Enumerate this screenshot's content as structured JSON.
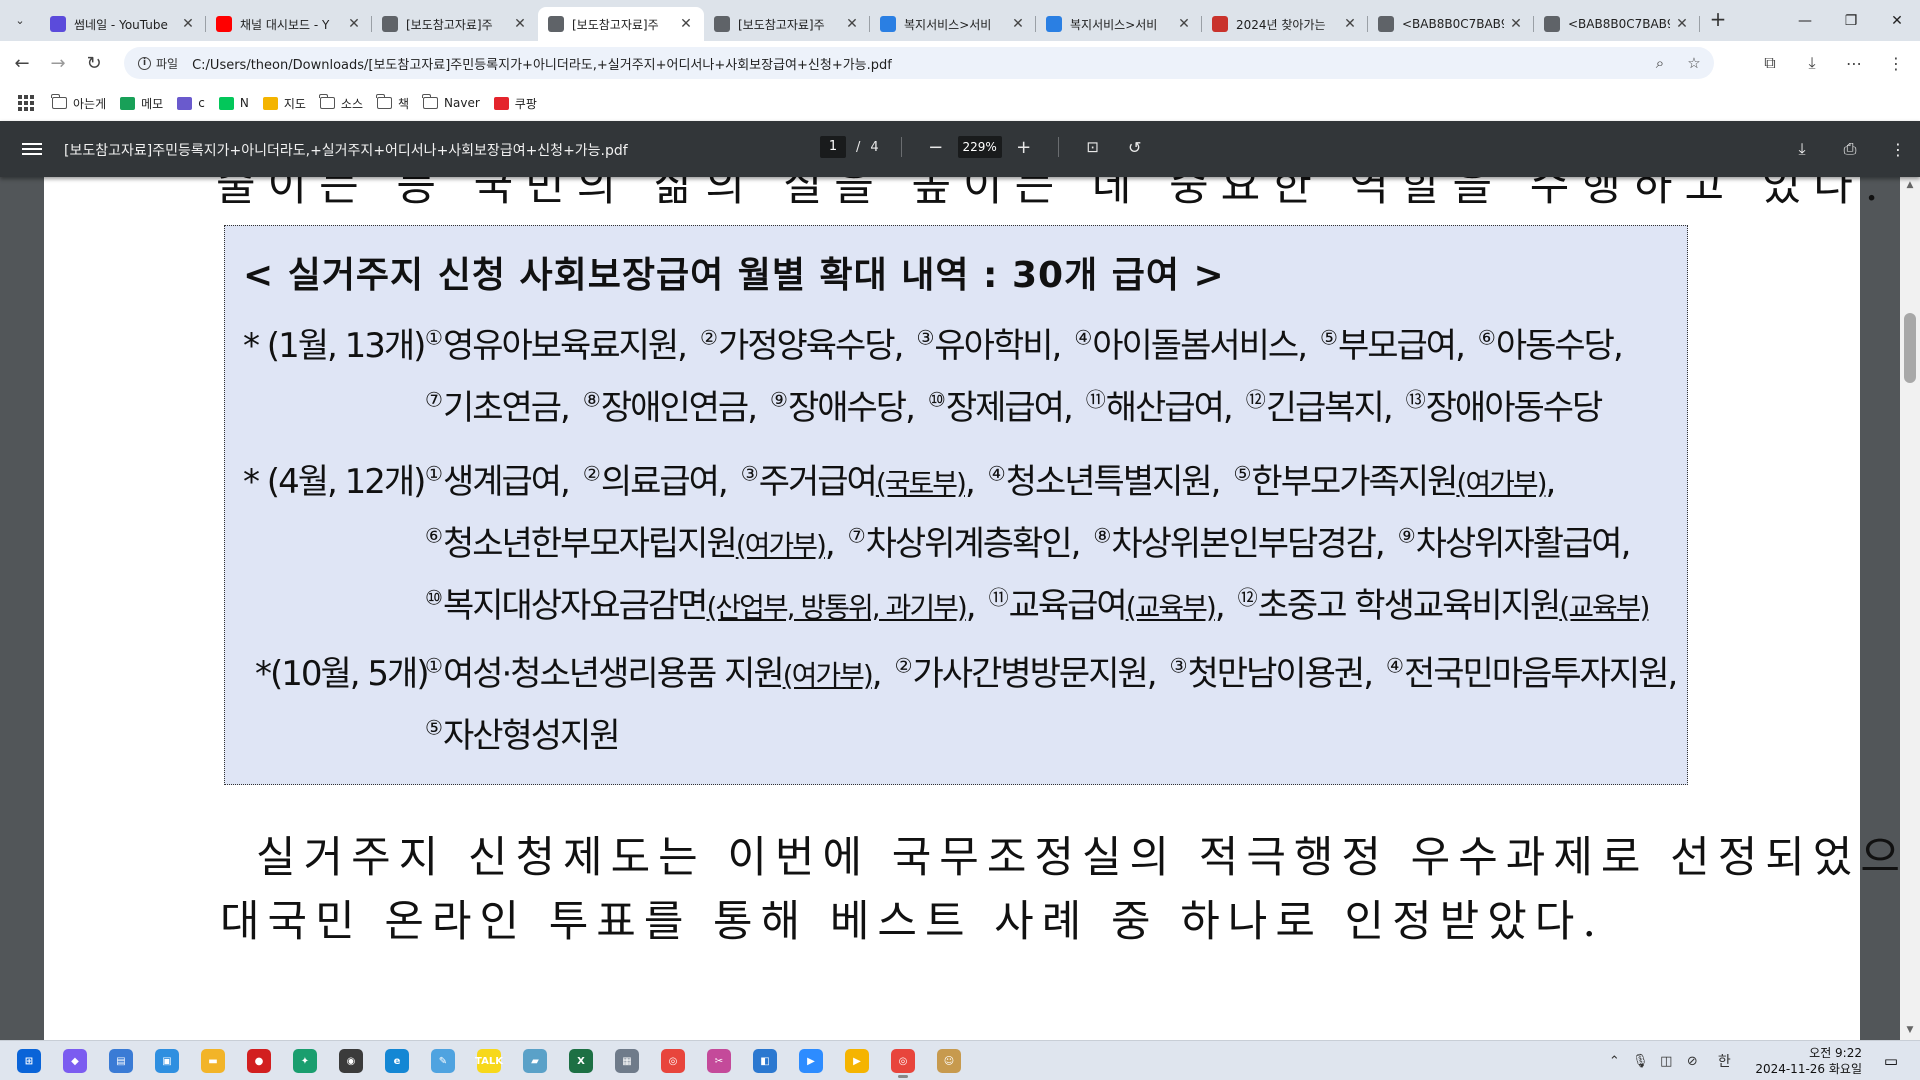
{
  "browser": {
    "tabs": [
      {
        "title": "썸네일 - YouTube",
        "icon": "youtube-studio-icon",
        "color": "#5b4bdb",
        "active": false
      },
      {
        "title": "채널 대시보드 - Y",
        "icon": "youtube-icon",
        "color": "#ff0000",
        "active": false
      },
      {
        "title": "[보도참고자료]주",
        "icon": "globe-icon",
        "color": "#5f6368",
        "active": false
      },
      {
        "title": "[보도참고자료]주",
        "icon": "globe-icon",
        "color": "#5f6368",
        "active": true
      },
      {
        "title": "[보도참고자료]주",
        "icon": "globe-icon",
        "color": "#5f6368",
        "active": false
      },
      {
        "title": "복지서비스>서비",
        "icon": "bokjiro-icon",
        "color": "#2a7fe3",
        "active": false
      },
      {
        "title": "복지서비스>서비",
        "icon": "bokjiro-icon",
        "color": "#2a7fe3",
        "active": false
      },
      {
        "title": "2024년 찾아가는",
        "icon": "korea-gov-icon",
        "color": "#c9332c",
        "active": false
      },
      {
        "title": "<BAB8B0C7BAB9",
        "icon": "globe-icon",
        "color": "#5f6368",
        "active": false
      },
      {
        "title": "<BAB8B0C7BAB9",
        "icon": "globe-icon",
        "color": "#5f6368",
        "active": false
      }
    ],
    "address": {
      "chip": "파일",
      "url": "C:/Users/theon/Downloads/[보도참고자료]주민등록지가+아니더라도,+실거주지+어디서나+사회보장급여+신청+가능.pdf"
    },
    "bookmarks": [
      {
        "label": "아는게",
        "type": "folder"
      },
      {
        "label": "메모",
        "type": "site",
        "color": "#18a058",
        "icon": "memo-icon"
      },
      {
        "label": "c",
        "type": "site",
        "color": "#6a5acd",
        "icon": "calendar-icon"
      },
      {
        "label": "N",
        "type": "site",
        "color": "#03c75a",
        "icon": "naver-icon"
      },
      {
        "label": "지도",
        "type": "site",
        "color": "#f4b400",
        "icon": "map-pin-icon"
      },
      {
        "label": "소스",
        "type": "folder"
      },
      {
        "label": "책",
        "type": "folder"
      },
      {
        "label": "Naver",
        "type": "folder"
      },
      {
        "label": "쿠팡",
        "type": "site",
        "color": "#e4242c",
        "icon": "coupang-icon"
      }
    ]
  },
  "pdf": {
    "title": "[보도참고자료]주민등록지가+아니더라도,+실거주지+어디서나+사회보장급여+신청+가능.pdf",
    "page_current": "1",
    "page_sep": "/",
    "page_total": "4",
    "zoom": "229%"
  },
  "document": {
    "top_line": "줄이는 등 국민의 삶의 질을 높이는 데 중요한 역할을 수행하고 있다.",
    "box_title": "< 실거주지 신청 사회보장급여 월별 확대 내역 : 30개 급여 >",
    "jan_label": "* (1월, 13개)",
    "jan_line1": [
      {
        "n": "①",
        "t": "영유아보육료지원,"
      },
      {
        "n": "②",
        "t": "가정양육수당,"
      },
      {
        "n": "③",
        "t": "유아학비,"
      },
      {
        "n": "④",
        "t": "아이돌봄서비스,"
      },
      {
        "n": "⑤",
        "t": "부모급여,"
      },
      {
        "n": "⑥",
        "t": "아동수당,"
      }
    ],
    "jan_line2": [
      {
        "n": "⑦",
        "t": "기초연금,"
      },
      {
        "n": "⑧",
        "t": "장애인연금,"
      },
      {
        "n": "⑨",
        "t": "장애수당,"
      },
      {
        "n": "⑩",
        "t": "장제급여,"
      },
      {
        "n": "⑪",
        "t": "해산급여,"
      },
      {
        "n": "⑫",
        "t": "긴급복지,"
      },
      {
        "n": "⑬",
        "t": "장애아동수당"
      }
    ],
    "apr_label": "* (4월, 12개)",
    "apr_line1": [
      {
        "n": "①",
        "t": "생계급여,"
      },
      {
        "n": "②",
        "t": "의료급여,"
      },
      {
        "n": "③",
        "t": "주거급여",
        "a": "(국토부)",
        "s": ","
      },
      {
        "n": "④",
        "t": "청소년특별지원,"
      },
      {
        "n": "⑤",
        "t": "한부모가족지원",
        "a": "(여가부)",
        "s": ","
      }
    ],
    "apr_line2": [
      {
        "n": "⑥",
        "t": "청소년한부모자립지원",
        "a": "(여가부)",
        "s": ","
      },
      {
        "n": "⑦",
        "t": "차상위계층확인,"
      },
      {
        "n": "⑧",
        "t": "차상위본인부담경감,"
      },
      {
        "n": "⑨",
        "t": "차상위자활급여,"
      }
    ],
    "apr_line3": [
      {
        "n": "⑩",
        "t": "복지대상자요금감면",
        "a": "(산업부, 방통위, 과기부)",
        "s": ","
      },
      {
        "n": "⑪",
        "t": "교육급여",
        "a": "(교육부)",
        "s": ","
      },
      {
        "n": "⑫",
        "t": "초중고 학생교육비지원",
        "a": "(교육부)",
        "s": ""
      }
    ],
    "oct_label": "*(10월, 5개)",
    "oct_line1": [
      {
        "n": "①",
        "t": "여성·청소년생리용품 지원",
        "a": "(여가부)",
        "s": ","
      },
      {
        "n": "②",
        "t": "가사간병방문지원,"
      },
      {
        "n": "③",
        "t": "첫만남이용권,"
      },
      {
        "n": "④",
        "t": "전국민마음투자지원,"
      }
    ],
    "oct_line2": [
      {
        "n": "⑤",
        "t": "자산형성지원"
      }
    ],
    "para_line1": "실거주지 신청제도는 이번에 국무조정실의 적극행정 우수과제로 선정되었으며,",
    "para_line2": "대국민 온라인 투표를 통해 베스트 사례 중 하나로 인정받았다."
  },
  "taskbar": {
    "apps": [
      {
        "name": "windows-start-icon",
        "color": "#0a64d8",
        "glyph": "⊞"
      },
      {
        "name": "copilot-icon",
        "color": "#7b5cf0",
        "glyph": "◆"
      },
      {
        "name": "task-view-icon",
        "color": "#3a7bd5",
        "glyph": "▤"
      },
      {
        "name": "widgets-icon",
        "color": "#2e8fe0",
        "glyph": "▣"
      },
      {
        "name": "file-explorer-icon",
        "color": "#f2b428",
        "glyph": "▬"
      },
      {
        "name": "record-icon",
        "color": "#d21f1f",
        "glyph": "●"
      },
      {
        "name": "xbox-icon",
        "color": "#1a9e6e",
        "glyph": "✦"
      },
      {
        "name": "davinci-icon",
        "color": "#3b3b3b",
        "glyph": "◉"
      },
      {
        "name": "edge-icon",
        "color": "#1487d4",
        "glyph": "e"
      },
      {
        "name": "paint-icon",
        "color": "#4fa3e0",
        "glyph": "✎"
      },
      {
        "name": "kakaotalk-icon",
        "color": "#f7d81b",
        "glyph": "TALK"
      },
      {
        "name": "notes-icon",
        "color": "#5aa1c8",
        "glyph": "▰"
      },
      {
        "name": "excel-icon",
        "color": "#1d7044",
        "glyph": "X"
      },
      {
        "name": "calculator-icon",
        "color": "#6f7b8a",
        "glyph": "▦"
      },
      {
        "name": "chrome-icon",
        "color": "#e8453c",
        "glyph": "◎"
      },
      {
        "name": "snipping-icon",
        "color": "#c44a9a",
        "glyph": "✂"
      },
      {
        "name": "store-icon",
        "color": "#2b78d0",
        "glyph": "◧"
      },
      {
        "name": "zoom-icon",
        "color": "#2d8cff",
        "glyph": "▶"
      },
      {
        "name": "player-icon",
        "color": "#f5b400",
        "glyph": "▶"
      },
      {
        "name": "chrome-active-icon",
        "color": "#e8453c",
        "glyph": "◎"
      },
      {
        "name": "character-app-icon",
        "color": "#c79a4e",
        "glyph": "☺"
      }
    ],
    "ime": "한",
    "time": "오전 9:22",
    "date": "2024-11-26 화요일"
  }
}
